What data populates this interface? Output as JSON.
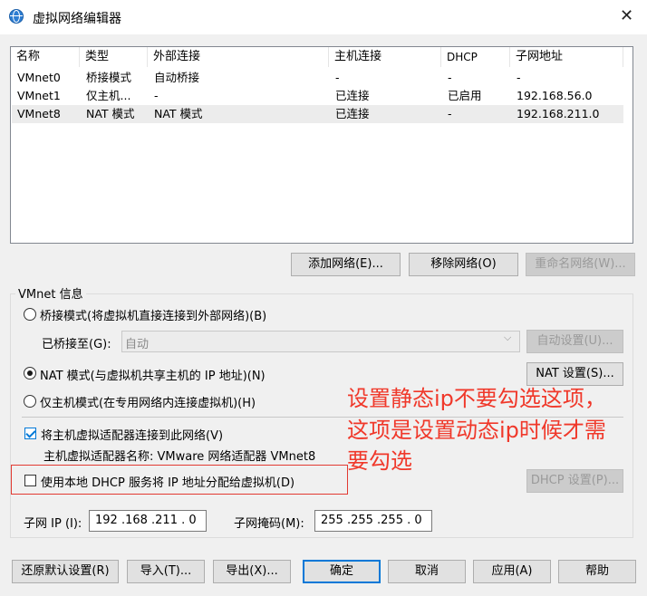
{
  "window": {
    "title": "虚拟网络编辑器",
    "close_glyph": "✕"
  },
  "table": {
    "headers": [
      "名称",
      "类型",
      "外部连接",
      "主机连接",
      "DHCP",
      "子网地址"
    ],
    "rows": [
      [
        "VMnet0",
        "桥接模式",
        "自动桥接",
        "-",
        "-",
        "-"
      ],
      [
        "VMnet1",
        "仅主机...",
        "-",
        "已连接",
        "已启用",
        "192.168.56.0"
      ],
      [
        "VMnet8",
        "NAT 模式",
        "NAT 模式",
        "已连接",
        "-",
        "192.168.211.0"
      ]
    ]
  },
  "buttons": {
    "add_network": "添加网络(E)...",
    "remove_network": "移除网络(O)",
    "rename_network": "重命名网络(W)...",
    "auto_settings": "自动设置(U)...",
    "nat_settings": "NAT 设置(S)...",
    "dhcp_settings": "DHCP 设置(P)...",
    "restore_defaults": "还原默认设置(R)",
    "import": "导入(T)...",
    "export": "导出(X)...",
    "ok": "确定",
    "cancel": "取消",
    "apply": "应用(A)",
    "help": "帮助"
  },
  "vmnet_info": {
    "group_label": "VMnet 信息",
    "bridged_label": "桥接模式(将虚拟机直接连接到外部网络)(B)",
    "bridged_to_label": "已桥接至(G):",
    "bridged_to_value": "自动",
    "nat_label": "NAT 模式(与虚拟机共享主机的 IP 地址)(N)",
    "host_only_label": "仅主机模式(在专用网络内连接虚拟机)(H)",
    "selected_mode": "nat",
    "connect_adapter_label": "将主机虚拟适配器连接到此网络(V)",
    "connect_adapter_checked": true,
    "adapter_name_label": "主机虚拟适配器名称: VMware 网络适配器 VMnet8",
    "use_dhcp_label": "使用本地 DHCP 服务将 IP 地址分配给虚拟机(D)",
    "use_dhcp_checked": false,
    "subnet_ip_label": "子网 IP (I):",
    "subnet_ip_value": "192 .168 .211 . 0",
    "subnet_mask_label": "子网掩码(M):",
    "subnet_mask_value": "255 .255 .255 . 0"
  },
  "annotation": {
    "lines": [
      "设置静态ip不要勾选这项，",
      "这项是设置动态ip时候才需",
      "要勾选"
    ],
    "color": "#f0382a"
  }
}
